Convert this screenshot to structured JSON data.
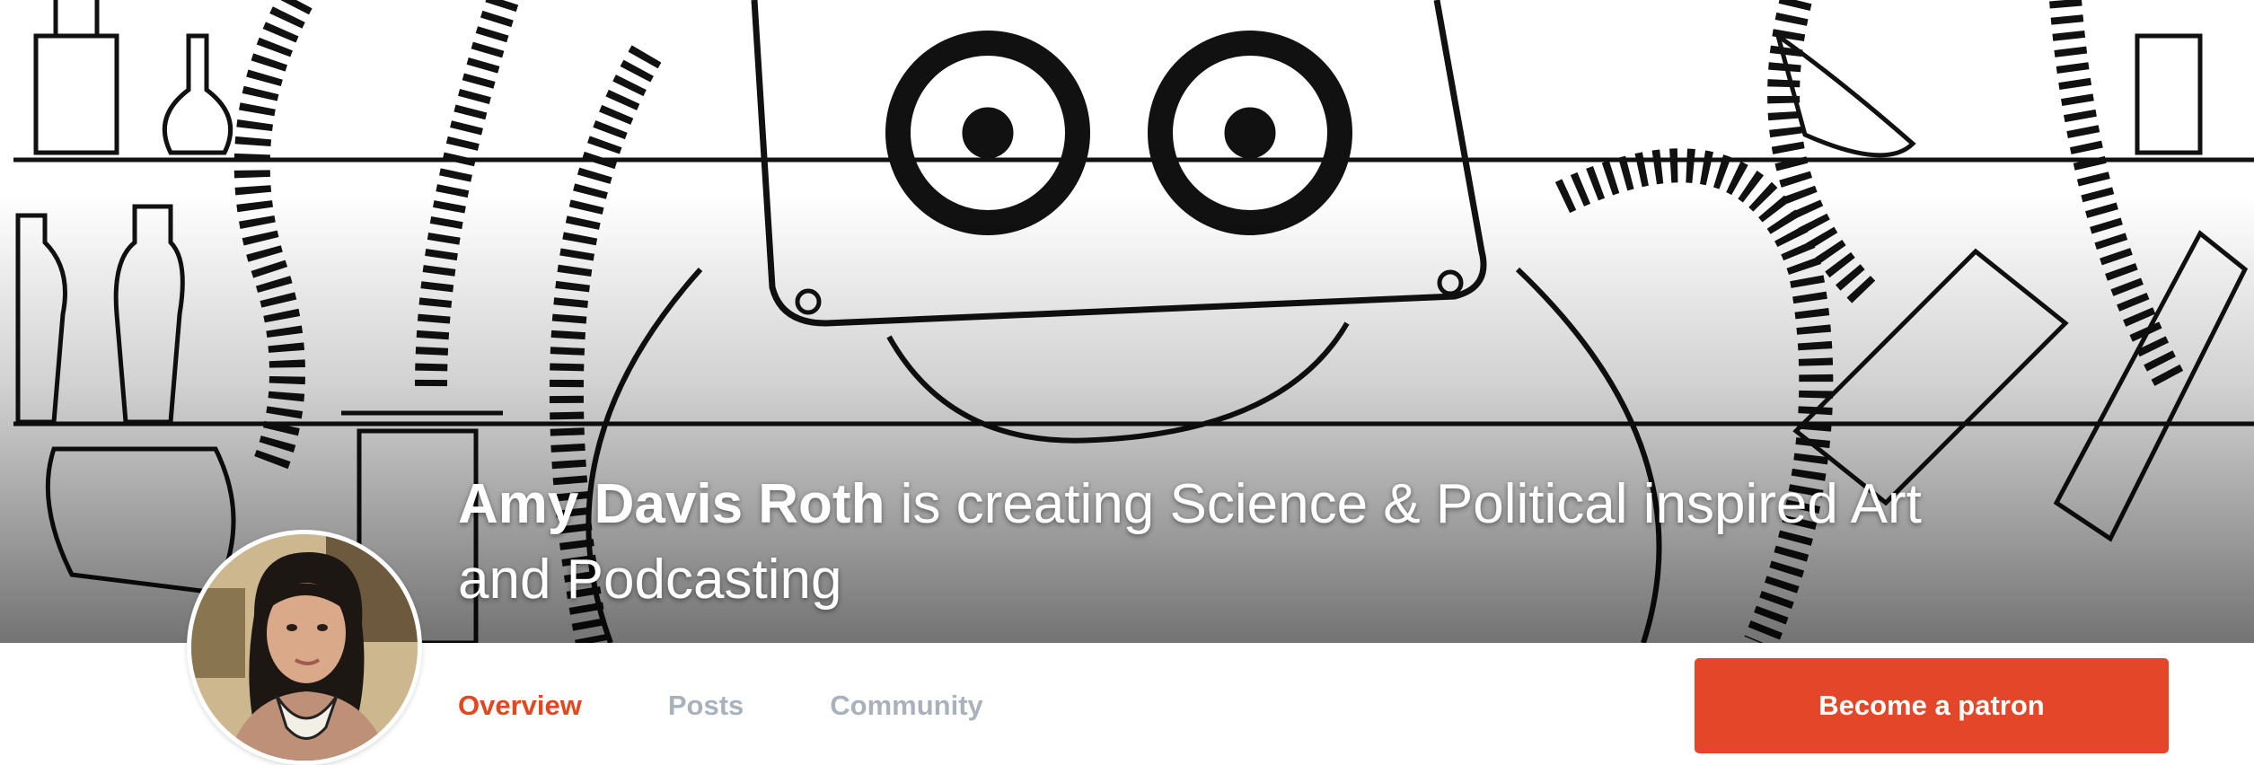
{
  "header": {
    "creator_name": "Amy Davis Roth",
    "tagline_line1": " is creating Science & Political inspired Art",
    "tagline_line2": "and Podcasting"
  },
  "tabs": [
    {
      "label": "Overview",
      "active": true
    },
    {
      "label": "Posts",
      "active": false
    },
    {
      "label": "Community",
      "active": false
    }
  ],
  "cta": {
    "label": "Become a patron"
  },
  "colors": {
    "accent": "#e34628",
    "tab_inactive": "#a9b2bc"
  }
}
